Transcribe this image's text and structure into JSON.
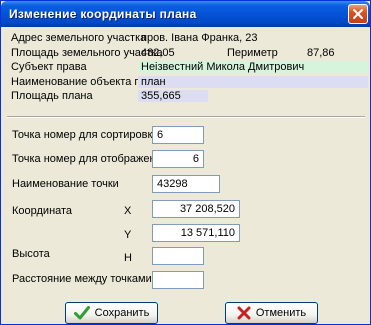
{
  "window": {
    "title": "Изменение координаты плана"
  },
  "info": {
    "address_label": "Адрес земельного участка",
    "address_value": "пров. Івана Франка, 23",
    "area_label": "Площадь земельного участка",
    "area_value": "482,05",
    "perimeter_label": "Периметр",
    "perimeter_value": "87,86",
    "subject_label": "Субъект права",
    "subject_value": "Неізвестний Микола Дмитрович",
    "object_name_label": "Наименование объекта план",
    "object_name_value": "план",
    "plan_area_label": "Площадь плана",
    "plan_area_value": "355,665"
  },
  "form": {
    "sort_number_label": "Точка номер для сортировки",
    "sort_number_value": "6",
    "display_number_label": "Точка номер для отображения",
    "display_number_value": "6",
    "point_name_label": "Наименование точки",
    "point_name_value": "43298",
    "coordinate_label": "Координата",
    "x_label": "X",
    "x_value": "37 208,520",
    "y_label": "Y",
    "y_value": "13 571,110",
    "height_label": "Высота",
    "h_label": "H",
    "h_value": "",
    "distance_label": "Расстояние между точками",
    "distance_value": ""
  },
  "buttons": {
    "save_label": "Сохранить",
    "cancel_label": "Отменить"
  },
  "colors": {
    "title_bar": "#0553d6",
    "close_button": "#d9531e",
    "dialog_bg": "#ece9d8",
    "subject_highlight": "#d6f3dc",
    "object_highlight": "#dcdcf2",
    "save_icon": "#2e9e2e",
    "cancel_icon": "#c8201e"
  },
  "icons": {
    "close": "close-icon",
    "save": "checkmark-icon",
    "cancel": "x-mark-icon"
  }
}
